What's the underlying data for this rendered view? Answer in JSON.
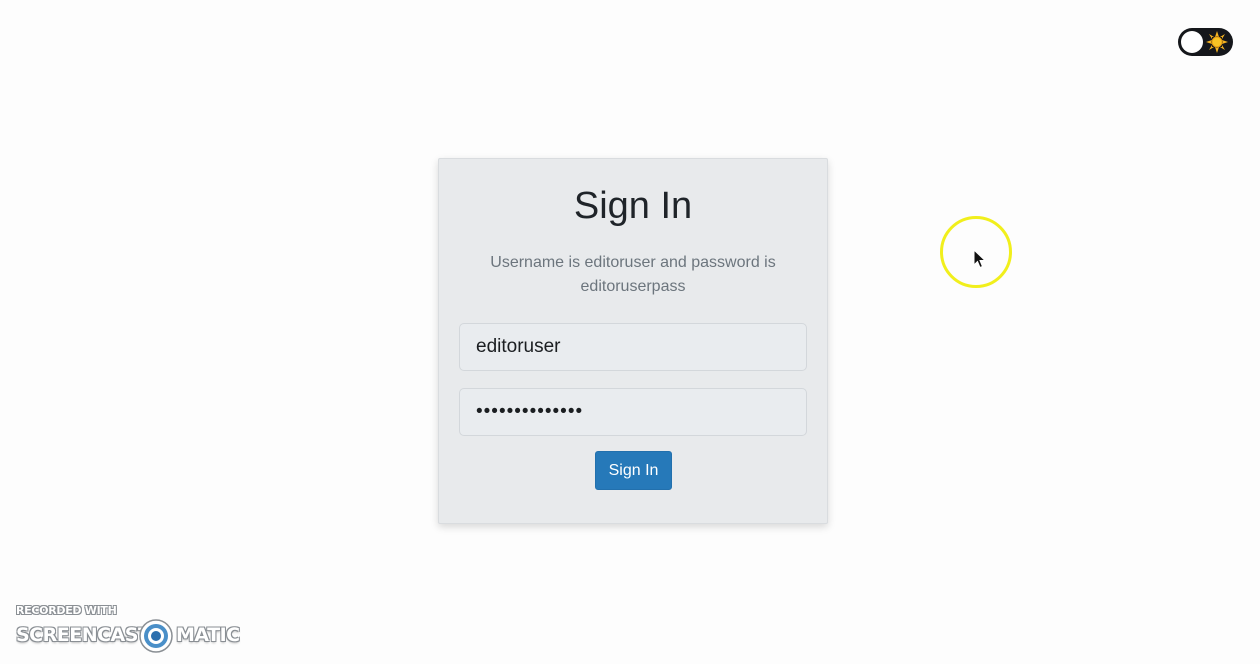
{
  "theme_toggle": {
    "icon": "sun-icon",
    "state": "light",
    "track_color": "#15171b"
  },
  "signin": {
    "title": "Sign In",
    "hint": "Username is editoruser and password is editoruserpass",
    "username_value": "editoruser",
    "password_value": "editoruserpass",
    "button_label": "Sign In",
    "button_color": "#2679b9"
  },
  "cursor": {
    "highlight_color": "#f1ef1c"
  },
  "watermark": {
    "line1": "RECORDED WITH",
    "brand_left": "SCREENCAST",
    "brand_right": "MATIC",
    "logo_icon": "screencast-o-matic-logo-icon"
  }
}
